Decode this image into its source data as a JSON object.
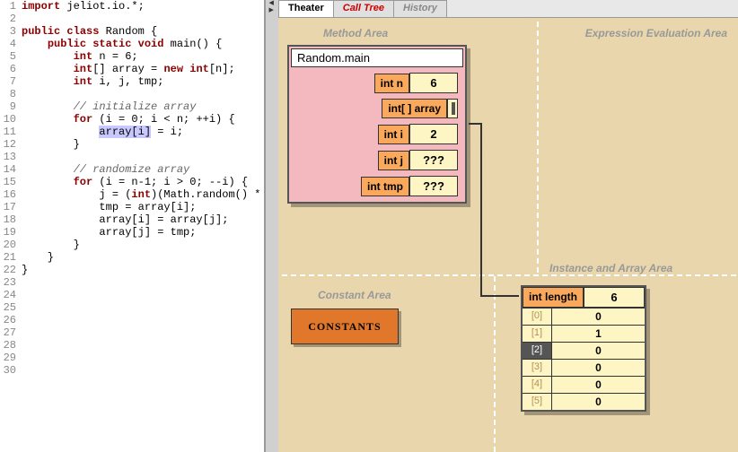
{
  "tabs": {
    "theater": "Theater",
    "calltree": "Call Tree",
    "history": "History"
  },
  "areas": {
    "method": "Method Area",
    "expr": "Expression Evaluation Area",
    "const": "Constant Area",
    "inst": "Instance and Array Area"
  },
  "frame": {
    "title": "Random.main",
    "vars": [
      {
        "label": "int n",
        "value": "6"
      },
      {
        "label": "int[ ] array",
        "ref": true
      },
      {
        "label": "int i",
        "value": "2"
      },
      {
        "label": "int j",
        "value": "???"
      },
      {
        "label": "int tmp",
        "value": "???"
      }
    ]
  },
  "constants_label": "CONSTANTS",
  "array": {
    "len_label": "int length",
    "len_value": "6",
    "indices": [
      "[0]",
      "[1]",
      "[2]",
      "[3]",
      "[4]",
      "[5]"
    ],
    "values": [
      "0",
      "1",
      "0",
      "0",
      "0",
      "0"
    ],
    "current": 2
  },
  "code": [
    {
      "n": 1,
      "t": [
        [
          "kw",
          "import"
        ],
        [
          "",
          " jeliot.io.*;"
        ]
      ]
    },
    {
      "n": 2,
      "t": [
        [
          "",
          ""
        ]
      ]
    },
    {
      "n": 3,
      "t": [
        [
          "kw",
          "public"
        ],
        [
          "",
          " "
        ],
        [
          "kw",
          "class"
        ],
        [
          "",
          " Random {"
        ]
      ]
    },
    {
      "n": 4,
      "t": [
        [
          "",
          "    "
        ],
        [
          "kw",
          "public"
        ],
        [
          "",
          " "
        ],
        [
          "kw",
          "static"
        ],
        [
          "",
          " "
        ],
        [
          "ty",
          "void"
        ],
        [
          "",
          " main() {"
        ]
      ]
    },
    {
      "n": 5,
      "t": [
        [
          "",
          "        "
        ],
        [
          "ty",
          "int"
        ],
        [
          "",
          " n = 6;"
        ]
      ]
    },
    {
      "n": 6,
      "t": [
        [
          "",
          "        "
        ],
        [
          "ty",
          "int"
        ],
        [
          "",
          "[] array = "
        ],
        [
          "kw",
          "new"
        ],
        [
          "",
          " "
        ],
        [
          "ty",
          "int"
        ],
        [
          "",
          "[n];"
        ]
      ]
    },
    {
      "n": 7,
      "t": [
        [
          "",
          "        "
        ],
        [
          "ty",
          "int"
        ],
        [
          "",
          " i, j, tmp;"
        ]
      ]
    },
    {
      "n": 8,
      "t": [
        [
          "",
          ""
        ]
      ]
    },
    {
      "n": 9,
      "t": [
        [
          "",
          "        "
        ],
        [
          "cm",
          "// initialize array"
        ]
      ]
    },
    {
      "n": 10,
      "t": [
        [
          "",
          "        "
        ],
        [
          "kw",
          "for"
        ],
        [
          "",
          " (i = 0; i < n; ++i) {"
        ]
      ]
    },
    {
      "n": 11,
      "t": [
        [
          "",
          "            "
        ],
        [
          "hl",
          "array[i]"
        ],
        [
          "",
          " = i;"
        ]
      ]
    },
    {
      "n": 12,
      "t": [
        [
          "",
          "        }"
        ]
      ]
    },
    {
      "n": 13,
      "t": [
        [
          "",
          ""
        ]
      ]
    },
    {
      "n": 14,
      "t": [
        [
          "",
          "        "
        ],
        [
          "cm",
          "// randomize array"
        ]
      ]
    },
    {
      "n": 15,
      "t": [
        [
          "",
          "        "
        ],
        [
          "kw",
          "for"
        ],
        [
          "",
          " (i = n-1; i > 0; --i) {"
        ]
      ]
    },
    {
      "n": 16,
      "t": [
        [
          "",
          "            j = ("
        ],
        [
          "ty",
          "int"
        ],
        [
          "",
          ")(Math.random() *"
        ]
      ]
    },
    {
      "n": 17,
      "t": [
        [
          "",
          "            tmp = array[i];"
        ]
      ]
    },
    {
      "n": 18,
      "t": [
        [
          "",
          "            array[i] = array[j];"
        ]
      ]
    },
    {
      "n": 19,
      "t": [
        [
          "",
          "            array[j] = tmp;"
        ]
      ]
    },
    {
      "n": 20,
      "t": [
        [
          "",
          "        }"
        ]
      ]
    },
    {
      "n": 21,
      "t": [
        [
          "",
          "    }"
        ]
      ]
    },
    {
      "n": 22,
      "t": [
        [
          "",
          "}"
        ]
      ]
    },
    {
      "n": 23,
      "t": [
        [
          "",
          ""
        ]
      ]
    },
    {
      "n": 24,
      "t": [
        [
          "",
          ""
        ]
      ]
    },
    {
      "n": 25,
      "t": [
        [
          "",
          ""
        ]
      ]
    },
    {
      "n": 26,
      "t": [
        [
          "",
          ""
        ]
      ]
    },
    {
      "n": 27,
      "t": [
        [
          "",
          ""
        ]
      ]
    },
    {
      "n": 28,
      "t": [
        [
          "",
          ""
        ]
      ]
    },
    {
      "n": 29,
      "t": [
        [
          "",
          ""
        ]
      ]
    },
    {
      "n": 30,
      "t": [
        [
          "",
          ""
        ]
      ]
    }
  ]
}
